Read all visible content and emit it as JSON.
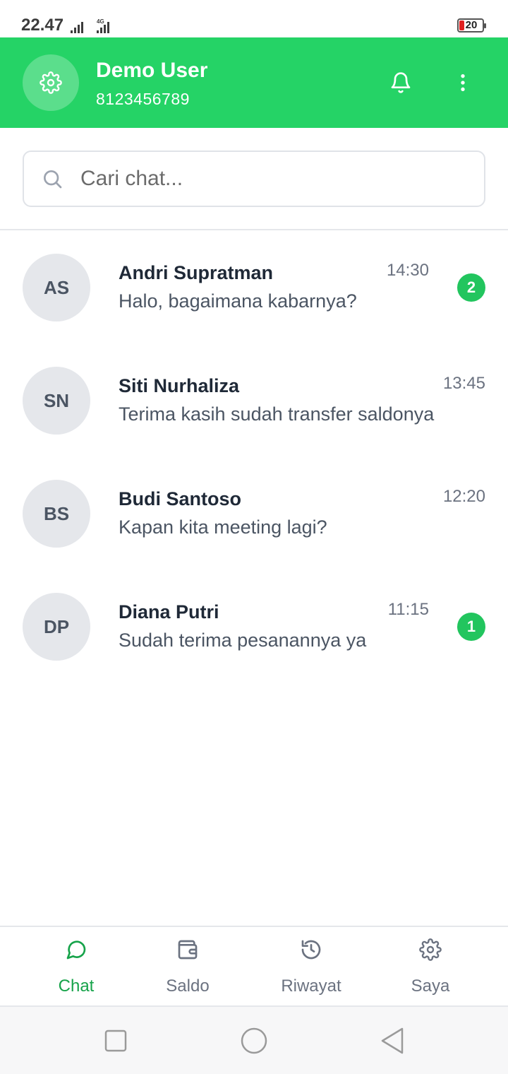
{
  "status_bar": {
    "time": "22.47",
    "network": "4G",
    "battery_level": "20"
  },
  "header": {
    "name": "Demo User",
    "phone": "8123456789",
    "avatar_icon": "gear-icon",
    "accent_color": "#25d366"
  },
  "search": {
    "placeholder": "Cari chat...",
    "value": ""
  },
  "chats": [
    {
      "initials": "AS",
      "name": "Andri Supratman",
      "message": "Halo, bagaimana kabarnya?",
      "time": "14:30",
      "unread": "2"
    },
    {
      "initials": "SN",
      "name": "Siti Nurhaliza",
      "message": "Terima kasih sudah transfer saldonya",
      "time": "13:45",
      "unread": ""
    },
    {
      "initials": "BS",
      "name": "Budi Santoso",
      "message": "Kapan kita meeting lagi?",
      "time": "12:20",
      "unread": ""
    },
    {
      "initials": "DP",
      "name": "Diana Putri",
      "message": "Sudah terima pesanannya ya",
      "time": "11:15",
      "unread": "1"
    }
  ],
  "bottom_nav": {
    "items": [
      {
        "label": "Chat",
        "icon": "chat-bubble-icon",
        "active": true
      },
      {
        "label": "Saldo",
        "icon": "wallet-icon",
        "active": false
      },
      {
        "label": "Riwayat",
        "icon": "history-icon",
        "active": false
      },
      {
        "label": "Saya",
        "icon": "gear-icon",
        "active": false
      }
    ]
  }
}
